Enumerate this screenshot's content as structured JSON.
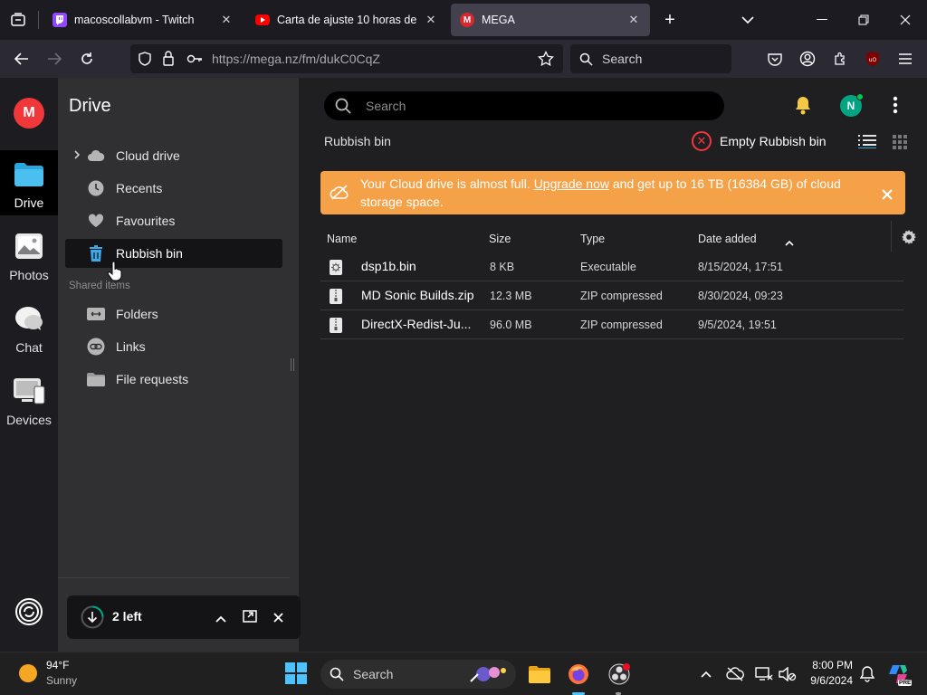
{
  "browser": {
    "tabs": [
      {
        "title": "macoscollabvm - Twitch",
        "favicon_color": "#9146ff",
        "active": false
      },
      {
        "title": "Carta de ajuste 10 horas de dura",
        "favicon_color": "#ff0000",
        "active": false
      },
      {
        "title": "MEGA",
        "favicon_color": "#d9272e",
        "active": true
      }
    ],
    "url_host": "https://mega.nz",
    "url_path": "/fm/dukC0CqZ",
    "search_placeholder": "Search"
  },
  "rail": {
    "logo": "M",
    "items": [
      {
        "label": "Drive",
        "active": true
      },
      {
        "label": "Photos",
        "active": false
      },
      {
        "label": "Chat",
        "active": false
      },
      {
        "label": "Devices",
        "active": false
      }
    ]
  },
  "sidebar": {
    "title": "Drive",
    "items": [
      {
        "label": "Cloud drive"
      },
      {
        "label": "Recents"
      },
      {
        "label": "Favourites"
      },
      {
        "label": "Rubbish bin",
        "active": true
      }
    ],
    "shared_header": "Shared items",
    "shared_items": [
      {
        "label": "Folders"
      },
      {
        "label": "Links"
      },
      {
        "label": "File requests"
      }
    ]
  },
  "main": {
    "search_placeholder": "Search",
    "avatar_initial": "N",
    "breadcrumb": "Rubbish bin",
    "empty_button": "Empty Rubbish bin",
    "banner": {
      "prefix": "Your Cloud drive is almost full. ",
      "link": "Upgrade now",
      "suffix": " and get up to 16 TB (16384 GB) of cloud storage space."
    },
    "columns": {
      "name": "Name",
      "size": "Size",
      "type": "Type",
      "date": "Date added"
    },
    "files": [
      {
        "name": "dsp1b.bin",
        "size": "8 KB",
        "type": "Executable",
        "date": "8/15/2024, 17:51"
      },
      {
        "name": "MD Sonic Builds.zip",
        "size": "12.3 MB",
        "type": "ZIP compressed",
        "date": "8/30/2024, 09:23"
      },
      {
        "name": "DirectX-Redist-Ju...",
        "size": "96.0 MB",
        "type": "ZIP compressed",
        "date": "9/5/2024, 19:51"
      }
    ]
  },
  "transfer": {
    "label": "2 left"
  },
  "taskbar": {
    "weather_temp": "94°F",
    "weather_desc": "Sunny",
    "search_placeholder": "Search",
    "time": "8:00 PM",
    "date": "9/6/2024",
    "copilot_badge": "PRE"
  },
  "colors": {
    "mega_red": "#f0373a",
    "banner_orange": "#f5a148",
    "online_green": "#00a382"
  }
}
